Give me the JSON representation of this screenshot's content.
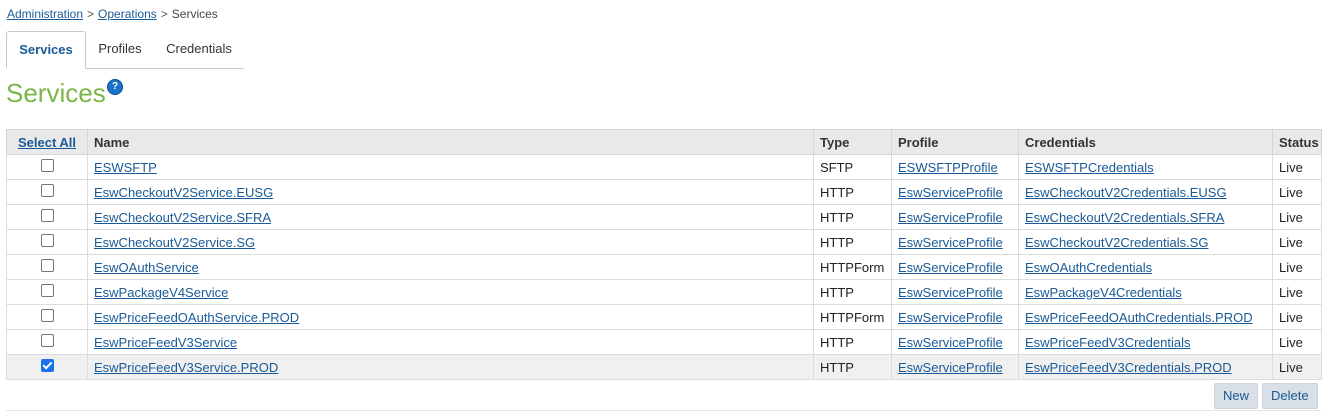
{
  "breadcrumb": {
    "items": [
      "Administration",
      "Operations"
    ],
    "separator": ">",
    "current": "Services"
  },
  "tabs": [
    {
      "label": "Services",
      "active": true
    },
    {
      "label": "Profiles",
      "active": false
    },
    {
      "label": "Credentials",
      "active": false
    }
  ],
  "page_title": "Services",
  "help_icon": "?",
  "table": {
    "select_all_label": "Select All",
    "columns": [
      "Name",
      "Type",
      "Profile",
      "Credentials",
      "Status"
    ],
    "rows": [
      {
        "checked": false,
        "name": "ESWSFTP",
        "type": "SFTP",
        "profile": "ESWSFTPProfile",
        "credentials": "ESWSFTPCredentials",
        "status": "Live"
      },
      {
        "checked": false,
        "name": "EswCheckoutV2Service.EUSG",
        "type": "HTTP",
        "profile": "EswServiceProfile",
        "credentials": "EswCheckoutV2Credentials.EUSG",
        "status": "Live"
      },
      {
        "checked": false,
        "name": "EswCheckoutV2Service.SFRA",
        "type": "HTTP",
        "profile": "EswServiceProfile",
        "credentials": "EswCheckoutV2Credentials.SFRA",
        "status": "Live"
      },
      {
        "checked": false,
        "name": "EswCheckoutV2Service.SG",
        "type": "HTTP",
        "profile": "EswServiceProfile",
        "credentials": "EswCheckoutV2Credentials.SG",
        "status": "Live"
      },
      {
        "checked": false,
        "name": "EswOAuthService",
        "type": "HTTPForm",
        "profile": "EswServiceProfile",
        "credentials": "EswOAuthCredentials",
        "status": "Live"
      },
      {
        "checked": false,
        "name": "EswPackageV4Service",
        "type": "HTTP",
        "profile": "EswServiceProfile",
        "credentials": "EswPackageV4Credentials",
        "status": "Live"
      },
      {
        "checked": false,
        "name": "EswPriceFeedOAuthService.PROD",
        "type": "HTTPForm",
        "profile": "EswServiceProfile",
        "credentials": "EswPriceFeedOAuthCredentials.PROD",
        "status": "Live"
      },
      {
        "checked": false,
        "name": "EswPriceFeedV3Service",
        "type": "HTTP",
        "profile": "EswServiceProfile",
        "credentials": "EswPriceFeedV3Credentials",
        "status": "Live"
      },
      {
        "checked": true,
        "name": "EswPriceFeedV3Service.PROD",
        "type": "HTTP",
        "profile": "EswServiceProfile",
        "credentials": "EswPriceFeedV3Credentials.PROD",
        "status": "Live"
      }
    ]
  },
  "buttons": {
    "new_label": "New",
    "delete_label": "Delete"
  },
  "colors": {
    "title_green": "#7ab648",
    "link_blue": "#1a5a96",
    "header_bg": "#e9e9e9",
    "button_bg": "#d9dfe6",
    "checkbox_checked": "#1a73e8"
  }
}
